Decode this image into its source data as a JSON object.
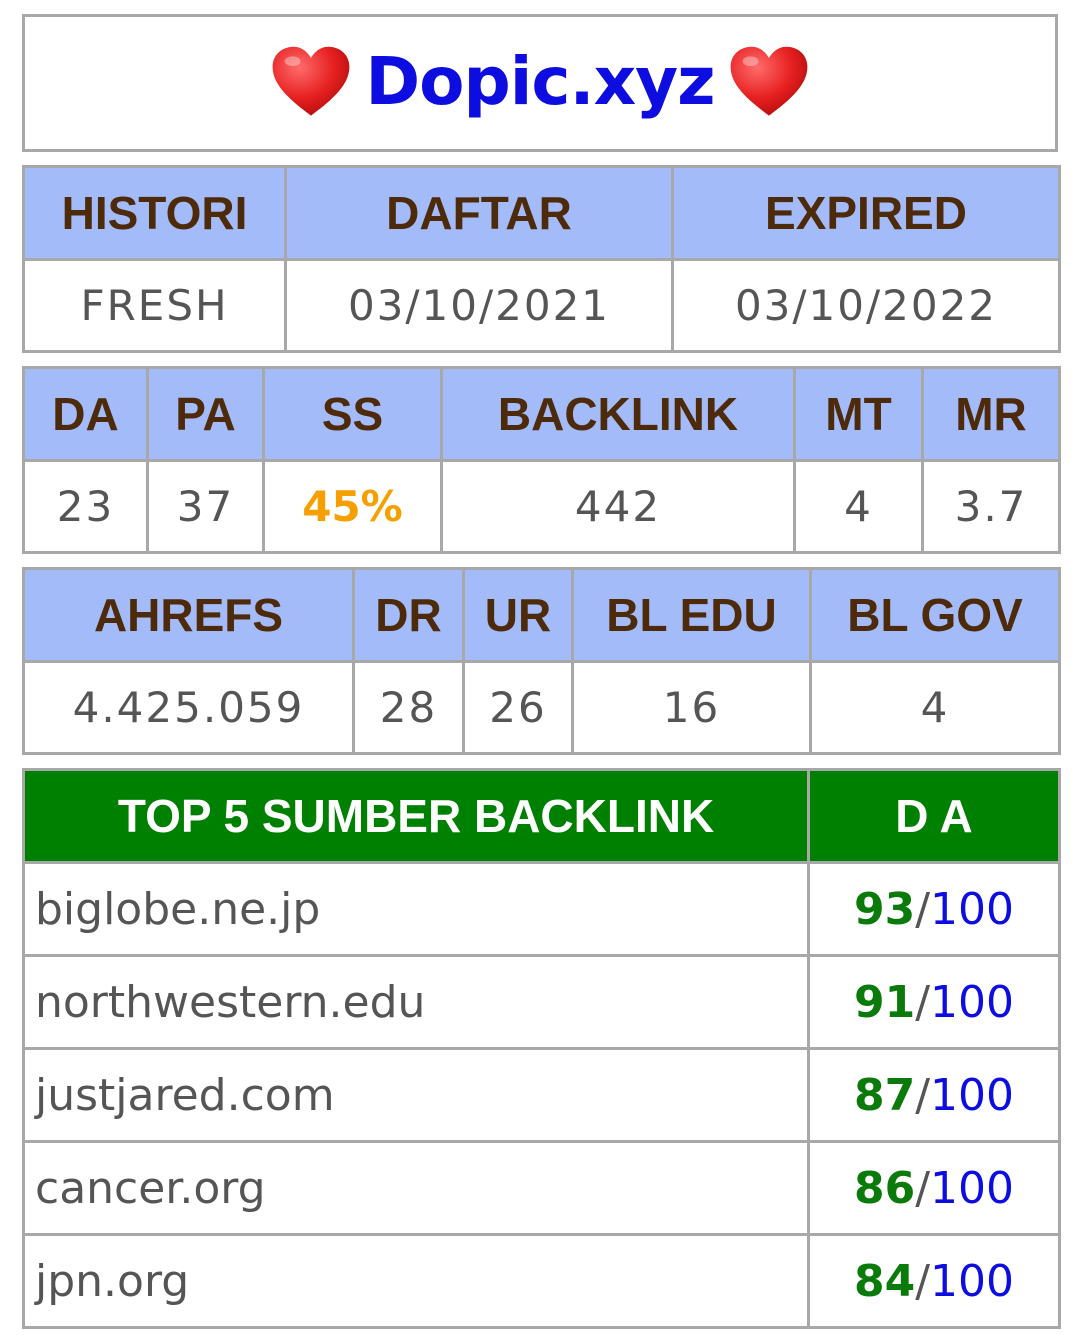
{
  "title": "Dopic.xyz",
  "colors": {
    "header_bg": "#a4bbf9",
    "header_text": "#4d2a0a",
    "top_header_bg": "#008000",
    "title": "#0d0de0",
    "ss_value": "#f5a000",
    "score_green": "#0a7a0a",
    "score_blue": "#0d0de0"
  },
  "domain_info": {
    "headers": [
      "HISTORI",
      "DAFTAR",
      "EXPIRED"
    ],
    "values": [
      "FRESH",
      "03/10/2021",
      "03/10/2022"
    ]
  },
  "moz": {
    "headers": [
      "DA",
      "PA",
      "SS",
      "BACKLINK",
      "MT",
      "MR"
    ],
    "values": [
      "23",
      "37",
      "45%",
      "442",
      "4",
      "3.7"
    ]
  },
  "ahrefs": {
    "headers": [
      "AHREFS",
      "DR",
      "UR",
      "BL EDU",
      "BL GOV"
    ],
    "values": [
      "4.425.059",
      "28",
      "26",
      "16",
      "4"
    ]
  },
  "top_backlinks": {
    "headers": [
      "TOP 5 SUMBER BACKLINK",
      "D A"
    ],
    "rows": [
      {
        "source": "biglobe.ne.jp",
        "da": "93",
        "sep": "/",
        "max": "100"
      },
      {
        "source": "northwestern.edu",
        "da": "91",
        "sep": "/",
        "max": "100"
      },
      {
        "source": "justjared.com",
        "da": "87",
        "sep": "/",
        "max": "100"
      },
      {
        "source": "cancer.org",
        "da": "86",
        "sep": "/",
        "max": "100"
      },
      {
        "source": "jpn.org",
        "da": "84",
        "sep": "/",
        "max": "100"
      }
    ]
  }
}
